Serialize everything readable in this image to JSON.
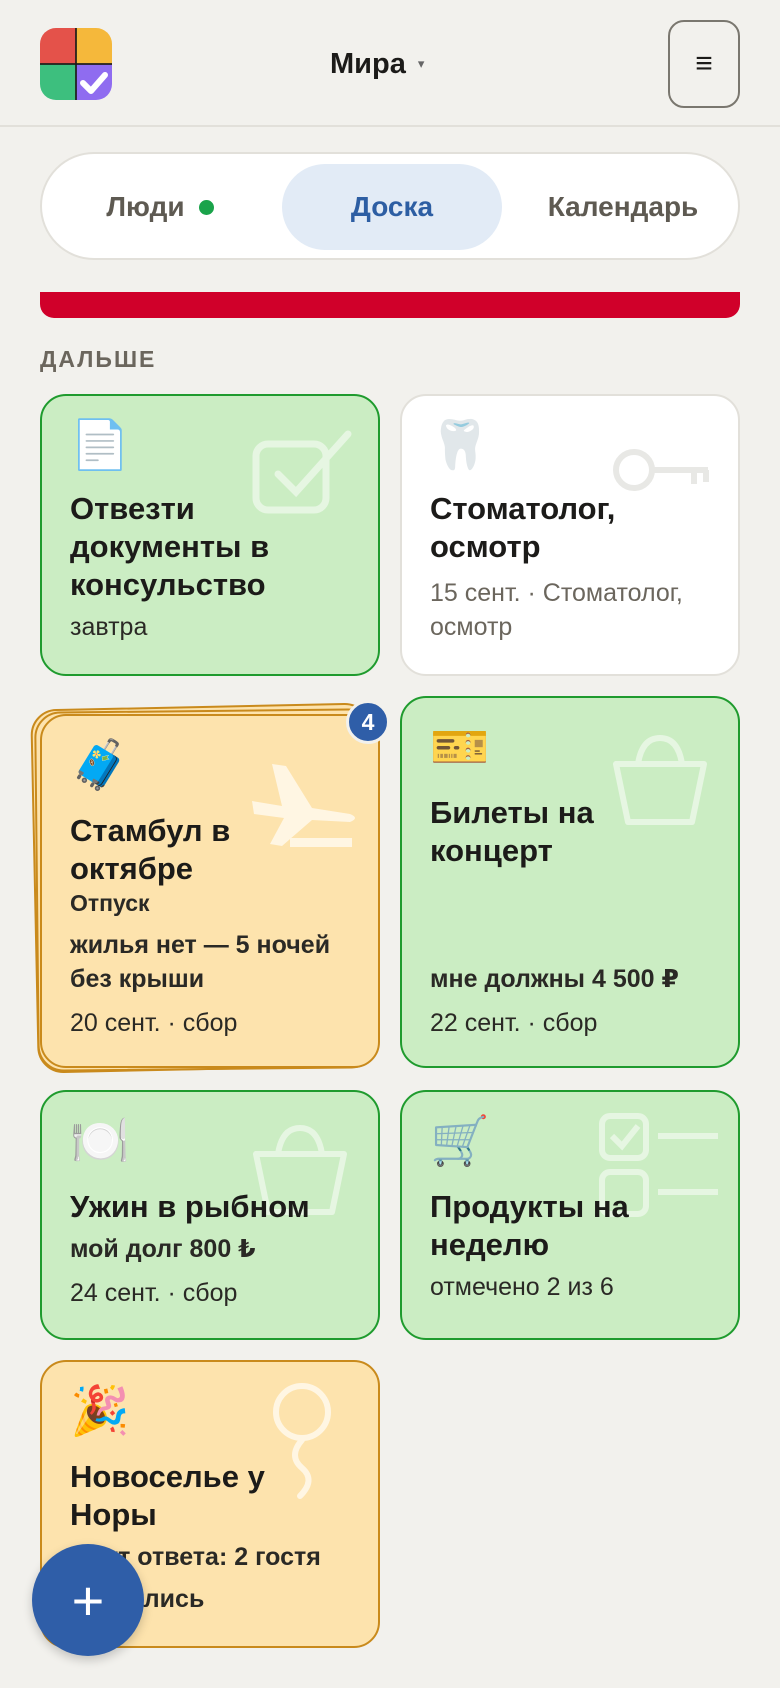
{
  "header": {
    "user_name": "Мира",
    "caret": "▾",
    "menu_icon": "≡"
  },
  "tabs": [
    {
      "label": "Люди",
      "status_dot_color": "#1aa34a"
    },
    {
      "label": "Доска",
      "active": true
    },
    {
      "label": "Календарь"
    }
  ],
  "section_label": "ДАЛЬШЕ",
  "cards": [
    {
      "emoji": "📄",
      "title_lines": [
        "Отвезти",
        "документы в",
        "консульство"
      ],
      "lines": [
        "завтра"
      ],
      "color": "green",
      "watermark_icon": "checkbox-icon"
    },
    {
      "emoji": "🦷",
      "title_lines": [
        "Стоматолог,",
        "осмотр"
      ],
      "lines": [
        "15 сент. · Стоматолог,",
        "осмотр"
      ],
      "color": "white",
      "watermark_icon": "key-icon"
    },
    {
      "emoji": "🧳",
      "title_lines": [
        "Стамбул в",
        "октябре"
      ],
      "subtitle": "Отпуск",
      "lines": [
        "жилья нет — 5 ночей",
        "без крыши"
      ],
      "meta": "20 сент. · сбор",
      "color": "amber",
      "stack_count": "4",
      "watermark_icon": "plane-icon"
    },
    {
      "emoji": "🎫",
      "title_lines": [
        "Билеты на",
        "концерт"
      ],
      "lines": [
        "мне должны 4 500 ₽"
      ],
      "meta": "22 сент. · сбор",
      "color": "green",
      "watermark_icon": "basket-icon"
    },
    {
      "emoji": "🍽️",
      "title_lines": [
        "Ужин в рыбном"
      ],
      "lines": [
        "мой долг 800 ₺"
      ],
      "meta": "24 сент. · сбор",
      "color": "green",
      "watermark_icon": "basket-icon"
    },
    {
      "emoji": "🛒",
      "title_lines": [
        "Продукты на",
        "неделю"
      ],
      "lines": [
        "отмечено 2 из 6"
      ],
      "color": "green",
      "watermark_icon": "checklist-icon"
    },
    {
      "emoji": "🎉",
      "title_lines": [
        "Новоселье у",
        "Норы"
      ],
      "lines": [
        "ждут ответа: 2 гостя",
        "собрались"
      ],
      "color": "amber",
      "watermark_icon": "balloon-icon"
    }
  ],
  "fab": {
    "label": "+"
  },
  "colors": {
    "background": "#f2f1ed",
    "green_card": "#cbedc3",
    "green_border": "#1f9b2e",
    "amber_card": "#fde3ad",
    "amber_border": "#c98a1c",
    "accent_blue": "#2f5ea8",
    "alert_red": "#d0002a"
  }
}
